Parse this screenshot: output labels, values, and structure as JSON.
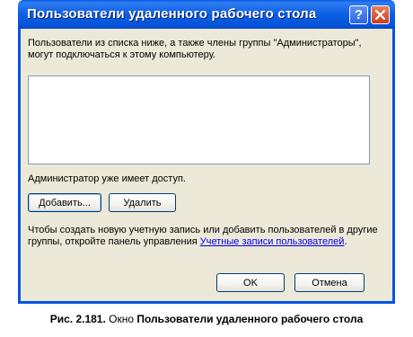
{
  "window": {
    "title": "Пользователи удаленного рабочего стола",
    "help_button": "?"
  },
  "dialog": {
    "description": "Пользователи из списка ниже, а также члены группы \"Администраторы\", могут подключаться к этому компьютеру.",
    "admin_note": "Администратор уже имеет доступ.",
    "add_button": "Добавить...",
    "remove_button": "Удалить",
    "info_text": "Чтобы создать новую учетную запись или добавить пользователей в другие группы, откройте панель управления ",
    "info_link": "Учетные записи пользователей",
    "info_end": ".",
    "ok_button": "OK",
    "cancel_button": "Отмена"
  },
  "caption": {
    "label": "Рис. 2.181.",
    "text": " Окно ",
    "bold": "Пользователи удаленного рабочего стола"
  },
  "colors": {
    "titlebar": "#0054e3",
    "dialog_bg": "#ece9d8",
    "link": "#0000ee"
  }
}
